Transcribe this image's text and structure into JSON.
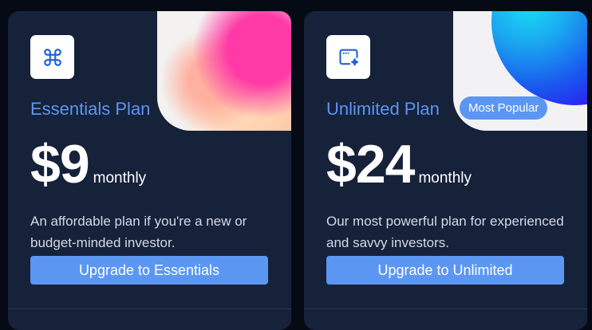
{
  "colors": {
    "page_background": "#060a15",
    "card_background": "#16213a",
    "accent": "#5b96f3",
    "text_primary": "#ffffff",
    "text_secondary": "#d3d9e4"
  },
  "plans": [
    {
      "icon": "command-key-icon",
      "title": "Essentials Plan",
      "badge": "",
      "price": "$9",
      "period": "monthly",
      "description": "An affordable plan if you're a new or budget-minded investor.",
      "cta_label": "Upgrade to Essentials"
    },
    {
      "icon": "sparkle-window-icon",
      "title": "Unlimited Plan",
      "badge": "Most Popular",
      "price": "$24",
      "period": "monthly",
      "description": "Our most powerful plan for experienced and savvy investors.",
      "cta_label": "Upgrade to Unlimited"
    }
  ]
}
